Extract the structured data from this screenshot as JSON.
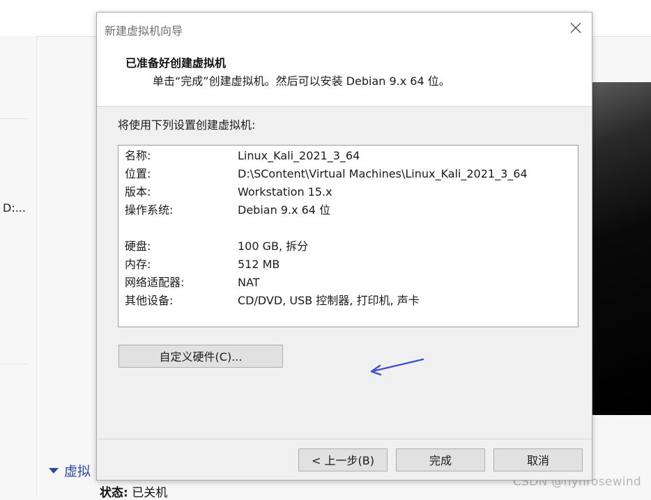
{
  "background": {
    "path_text": "D:...",
    "section_label": "虚拟",
    "status_label": "状态:",
    "status_value": "已关机",
    "watermark": "CSDN @hyhrosewind"
  },
  "dialog": {
    "title": "新建虚拟机向导",
    "header_title": "已准备好创建虚拟机",
    "header_subtitle": "单击“完成”创建虚拟机。然后可以安装 Debian 9.x 64 位。",
    "intro": "将使用下列设置创建虚拟机:",
    "summary": [
      {
        "key": "名称:",
        "value": "Linux_Kali_2021_3_64"
      },
      {
        "key": "位置:",
        "value": "D:\\SContent\\Virtual Machines\\Linux_Kali_2021_3_64"
      },
      {
        "key": "版本:",
        "value": "Workstation 15.x"
      },
      {
        "key": "操作系统:",
        "value": "Debian 9.x 64 位"
      },
      {
        "key": "硬盘:",
        "value": "100 GB, 拆分"
      },
      {
        "key": "内存:",
        "value": "512 MB"
      },
      {
        "key": "网络适配器:",
        "value": "NAT"
      },
      {
        "key": "其他设备:",
        "value": "CD/DVD, USB 控制器, 打印机, 声卡"
      }
    ],
    "customize_button": "自定义硬件(C)...",
    "back_button": "< 上一步(B)",
    "finish_button": "完成",
    "cancel_button": "取消"
  },
  "colors": {
    "annotation_arrow": "#3f4fd0",
    "section_link": "#2a4aa0"
  },
  "icons": {
    "close": "close-icon",
    "collapse": "triangle-down-icon",
    "annotation": "arrow-icon"
  }
}
